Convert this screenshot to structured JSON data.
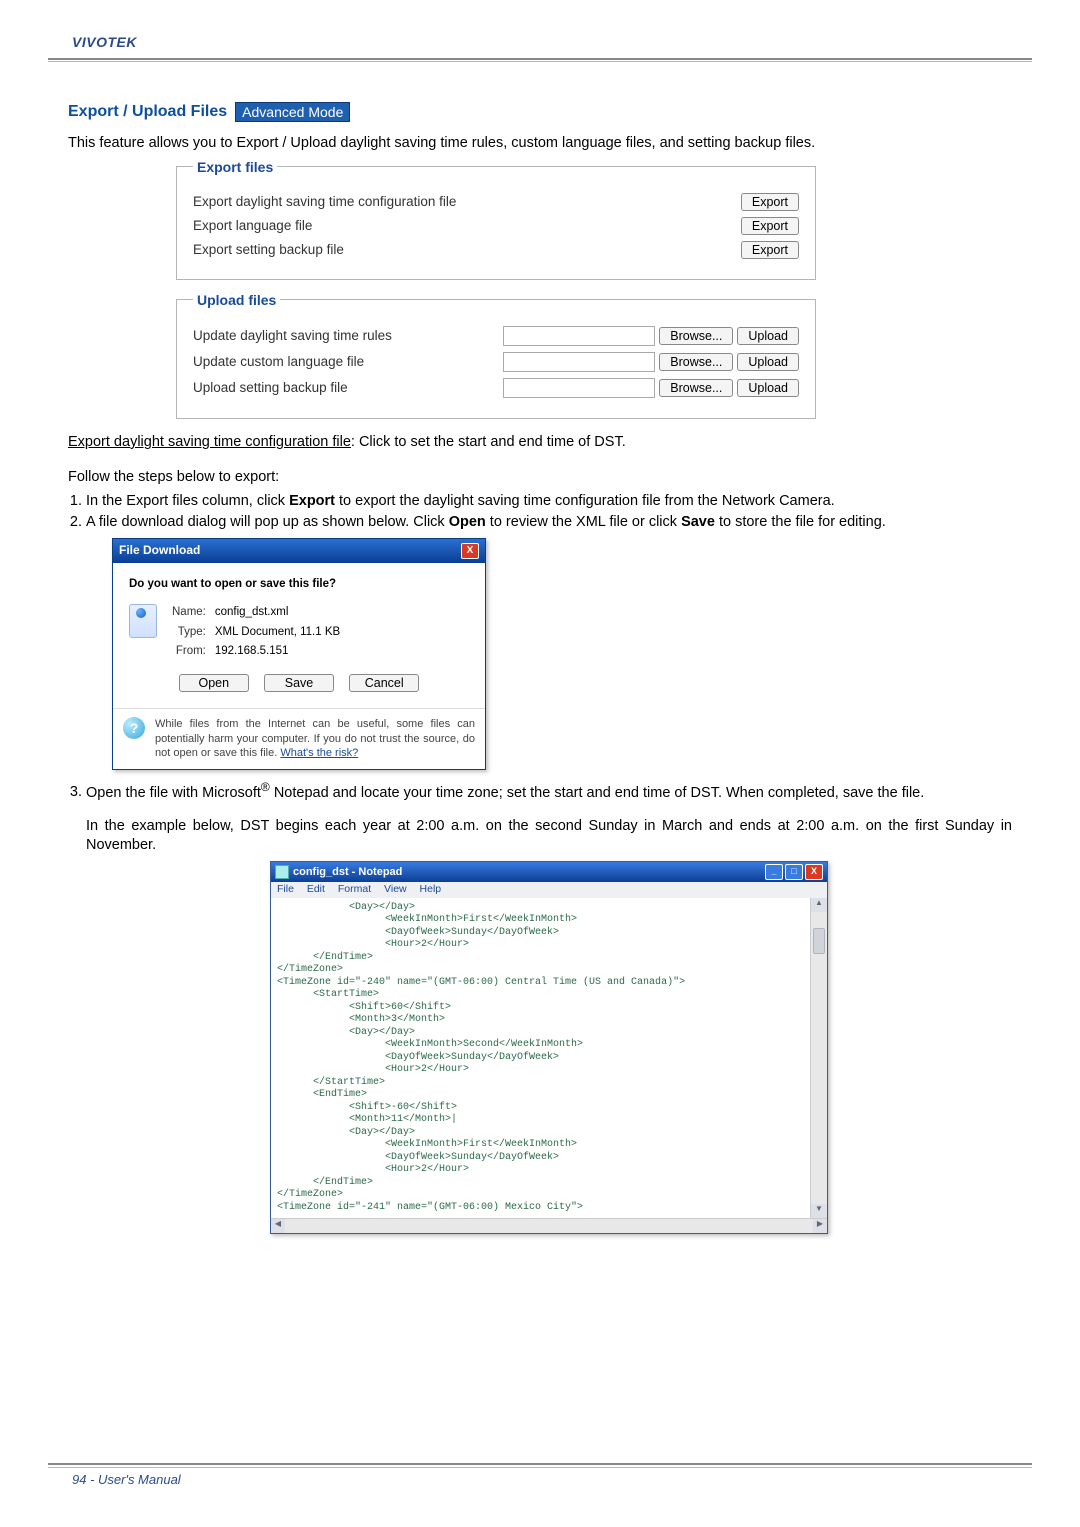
{
  "header": {
    "brand": "VIVOTEK"
  },
  "section": {
    "title": "Export / Upload Files",
    "badge": "Advanced Mode"
  },
  "intro": "This feature allows you to Export / Upload daylight saving time rules, custom language files, and setting backup files.",
  "export_panel": {
    "legend": "Export files",
    "rows": [
      {
        "label": "Export daylight saving time configuration file",
        "button": "Export"
      },
      {
        "label": "Export language file",
        "button": "Export"
      },
      {
        "label": "Export setting backup file",
        "button": "Export"
      }
    ]
  },
  "upload_panel": {
    "legend": "Upload files",
    "rows": [
      {
        "label": "Update daylight saving time rules",
        "browse": "Browse...",
        "upload": "Upload"
      },
      {
        "label": "Update custom language file",
        "browse": "Browse...",
        "upload": "Upload"
      },
      {
        "label": "Upload setting backup file",
        "browse": "Browse...",
        "upload": "Upload"
      }
    ]
  },
  "desc1_u": "Export daylight saving time configuration file",
  "desc1_rest": ": Click to set the start and end time of DST.",
  "steps_intro": "Follow the steps below to export:",
  "step1_a": "In the Export files column, click ",
  "step1_b": "Export",
  "step1_c": " to export the daylight saving time configuration file from the Network Camera.",
  "step2_a": "A file download dialog will pop up as shown below. Click ",
  "step2_b": "Open",
  "step2_c": " to review the XML file or click ",
  "step2_d": "Save",
  "step2_e": " to store the file for editing.",
  "file_download": {
    "title": "File Download",
    "question": "Do you want to open or save this file?",
    "name_label": "Name:",
    "name": "config_dst.xml",
    "type_label": "Type:",
    "type": "XML Document, 11.1 KB",
    "from_label": "From:",
    "from": "192.168.5.151",
    "open": "Open",
    "save": "Save",
    "cancel": "Cancel",
    "warn": "While files from the Internet can be useful, some files can potentially harm your computer. If you do not trust the source, do not open or save this file. ",
    "warn_link": "What's the risk?"
  },
  "step3_a": "Open the file with Microsoft",
  "step3_b": " Notepad and locate your time zone; set the start and end time of DST. When completed, save the file.",
  "step3_sup": "®",
  "example": "In the example below, DST begins each year at 2:00 a.m. on the second Sunday in March and ends at 2:00 a.m. on the first Sunday in November.",
  "notepad": {
    "title": "config_dst - Notepad",
    "menu": [
      "File",
      "Edit",
      "Format",
      "View",
      "Help"
    ],
    "content": "            <Day></Day>\n                  <WeekInMonth>First</WeekInMonth>\n                  <DayOfWeek>Sunday</DayOfWeek>\n                  <Hour>2</Hour>\n      </EndTime>\n</TimeZone>\n<TimeZone id=\"-240\" name=\"(GMT-06:00) Central Time (US and Canada)\">\n      <StartTime>\n            <Shift>60</Shift>\n            <Month>3</Month>\n            <Day></Day>\n                  <WeekInMonth>Second</WeekInMonth>\n                  <DayOfWeek>Sunday</DayOfWeek>\n                  <Hour>2</Hour>\n      </StartTime>\n      <EndTime>\n            <Shift>-60</Shift>\n            <Month>11</Month>|\n            <Day></Day>\n                  <WeekInMonth>First</WeekInMonth>\n                  <DayOfWeek>Sunday</DayOfWeek>\n                  <Hour>2</Hour>\n      </EndTime>\n</TimeZone>\n<TimeZone id=\"-241\" name=\"(GMT-06:00) Mexico City\">"
  },
  "footer": {
    "text": "94 - User's Manual"
  }
}
